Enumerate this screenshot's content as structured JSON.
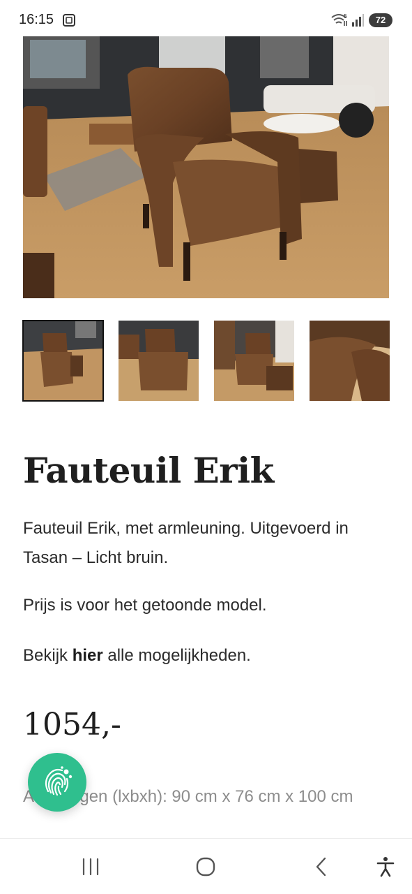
{
  "status_bar": {
    "time": "16:15",
    "battery": "72",
    "icons": [
      "sim-icon",
      "wifi-icon",
      "signal-icon",
      "battery-icon"
    ]
  },
  "gallery": {
    "main_image": "armchair-photo",
    "thumbnails": [
      "thumbnail-1",
      "thumbnail-2",
      "thumbnail-3",
      "thumbnail-4"
    ],
    "active_thumbnail": 0
  },
  "product": {
    "title": "Fauteuil Erik",
    "description_line": "Fauteuil Erik, met armleuning. Uitgevoerd in Tasan – Licht bruin.",
    "price_note": "Prijs is voor het getoonde model.",
    "options_prefix": "Bekijk ",
    "options_link": "hier",
    "options_suffix": " alle mogelijkheden.",
    "price": "1054,-",
    "dimensions_visible": "A",
    "dimensions_rest": "ngen (lxbxh): 90 cm x 76 cm x 100 cm"
  },
  "floating_button": {
    "icon": "fingerprint-icon",
    "color": "#2fbf8e"
  },
  "nav_bar": {
    "icons": [
      "recent-apps-icon",
      "home-icon",
      "back-icon",
      "accessibility-icon"
    ]
  }
}
